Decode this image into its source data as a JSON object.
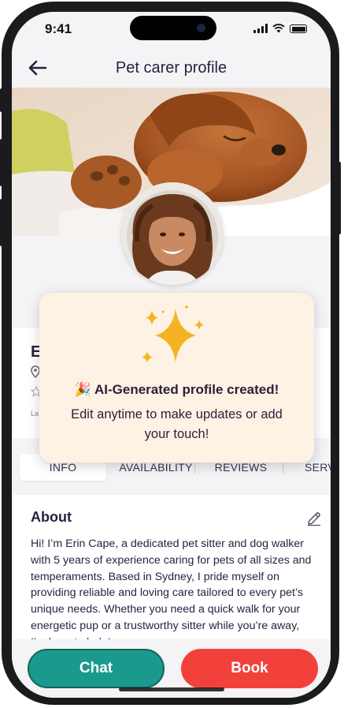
{
  "status_bar": {
    "time": "9:41"
  },
  "header": {
    "title": "Pet carer profile"
  },
  "profile": {
    "name_fragment": "E",
    "small_fragment": "La"
  },
  "toast": {
    "emoji": "🎉",
    "title": "AI-Generated profile created!",
    "message": "Edit anytime to make updates or add your touch!"
  },
  "tabs": [
    {
      "label": "INFO",
      "active": true
    },
    {
      "label": "AVAILABILITY",
      "active": false
    },
    {
      "label": "REVIEWS",
      "active": false
    },
    {
      "label": "SERVIC",
      "active": false
    }
  ],
  "about": {
    "title": "About",
    "text": "Hi! I’m Erin Cape, a dedicated pet sitter and dog walker with 5 years of experience caring for pets of all sizes and temperaments. Based in Sydney, I pride myself on providing reliable and loving care tailored to every pet’s unique needs. Whether you need a quick walk for your energetic pup or a trustworthy sitter while you’re away, I’m here to help!"
  },
  "actions": {
    "chat_label": "Chat",
    "book_label": "Book"
  },
  "colors": {
    "primary_text": "#2a1f3d",
    "chat": "#1a9a8c",
    "book": "#f2413b",
    "toast_bg": "#fdf2e3",
    "sparkle": "#f5b323"
  },
  "icons": [
    "back-arrow-icon",
    "location-pin-icon",
    "star-icon",
    "edit-pencil-icon",
    "sparkle-icon"
  ]
}
